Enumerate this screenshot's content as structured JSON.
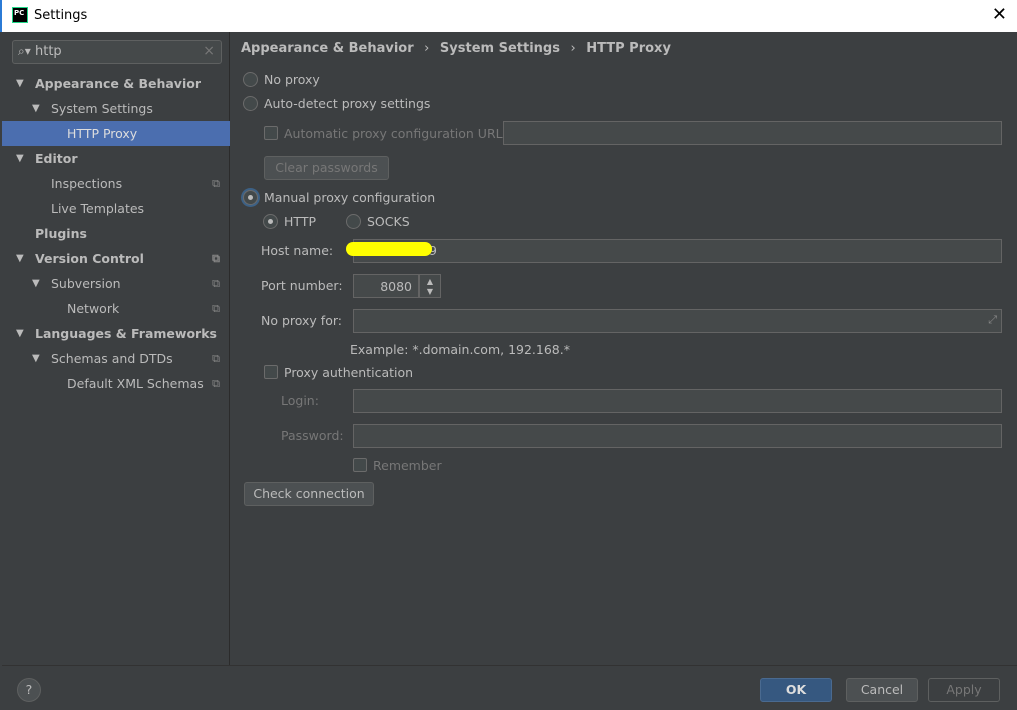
{
  "window": {
    "title": "Settings",
    "logo": "PC",
    "close": "✕"
  },
  "search": {
    "value": "http"
  },
  "tree": [
    {
      "label": "Appearance & Behavior",
      "bold": true
    },
    {
      "label": "System Settings"
    },
    {
      "label": "HTTP Proxy"
    },
    {
      "label": "Editor",
      "bold": true
    },
    {
      "label": "Inspections"
    },
    {
      "label": "Live Templates"
    },
    {
      "label": "Plugins",
      "bold": true
    },
    {
      "label": "Version Control",
      "bold": true
    },
    {
      "label": "Subversion"
    },
    {
      "label": "Network"
    },
    {
      "label": "Languages & Frameworks",
      "bold": true
    },
    {
      "label": "Schemas and DTDs"
    },
    {
      "label": "Default XML Schemas"
    }
  ],
  "breadcrumb": {
    "a": "Appearance & Behavior",
    "b": "System Settings",
    "c": "HTTP Proxy",
    "sep": "›"
  },
  "proxy": {
    "no_proxy": "No proxy",
    "auto_detect": "Auto-detect proxy settings",
    "auto_url": "Automatic proxy configuration URL:",
    "clear_passwords": "Clear passwords",
    "manual": "Manual proxy configuration",
    "http": "HTTP",
    "socks": "SOCKS",
    "host_label": "Host name:",
    "host_value": "9",
    "port_label": "Port number:",
    "port_value": "8080",
    "no_proxy_for": "No proxy for:",
    "example": "Example: *.domain.com, 192.168.*",
    "proxy_auth": "Proxy authentication",
    "login": "Login:",
    "password": "Password:",
    "remember": "Remember",
    "check": "Check connection",
    "selected": "manual",
    "protocol": "HTTP"
  },
  "footer": {
    "help": "?",
    "ok": "OK",
    "cancel": "Cancel",
    "apply": "Apply"
  },
  "colors": {
    "accent": "#4b6eaf",
    "ok": "#365880",
    "redaction": "#ffff00"
  }
}
